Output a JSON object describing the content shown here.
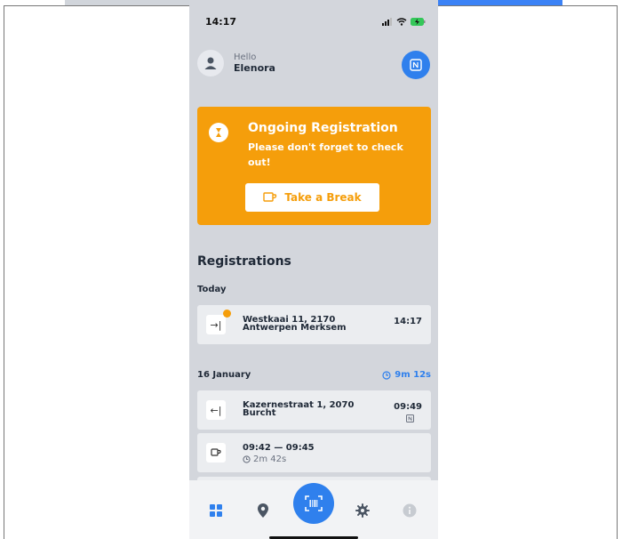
{
  "status_bar": {
    "time": "14:17"
  },
  "greeting": {
    "hello": "Hello",
    "name": "Elenora"
  },
  "alert": {
    "title": "Ongoing Registration",
    "message": "Please don't forget to check out!",
    "break_button": "Take a Break"
  },
  "registrations": {
    "title": "Registrations",
    "today": {
      "label": "Today",
      "items": [
        {
          "address_line1": "Westkaai 11, 2170",
          "address_line2": "Antwerpen Merksem",
          "time": "14:17"
        }
      ]
    },
    "day2": {
      "label": "16 January",
      "duration": "9m 12s",
      "items": [
        {
          "address_line1": "Kazernestraat 1, 2070",
          "address_line2": "Burcht",
          "time": "09:49"
        },
        {
          "break_range": "09:42  —  09:45",
          "break_duration": "2m 42s"
        }
      ]
    }
  },
  "colors": {
    "accent": "#2f80ed",
    "warning": "#f59e0b",
    "background": "#d3d6dc"
  }
}
